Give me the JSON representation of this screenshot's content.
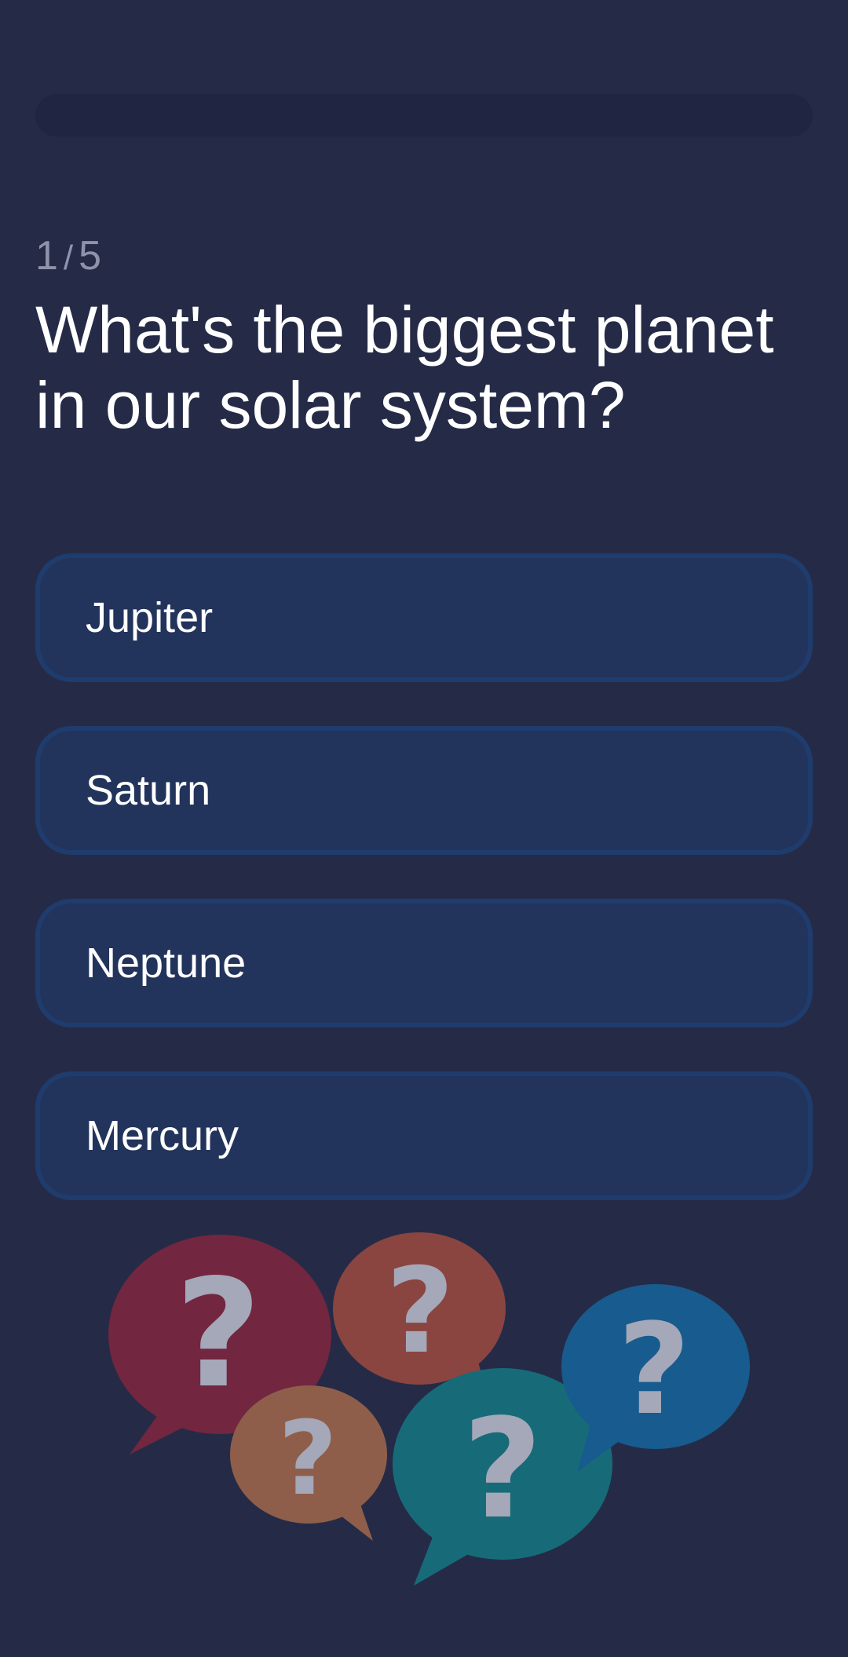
{
  "progress": {
    "value": 0
  },
  "counter": {
    "current": "1",
    "separator": "/",
    "total": "5"
  },
  "question": {
    "text": "What's the biggest planet in our solar system?"
  },
  "answers": [
    {
      "label": "Jupiter"
    },
    {
      "label": "Saturn"
    },
    {
      "label": "Neptune"
    },
    {
      "label": "Mercury"
    }
  ],
  "illustration": {
    "icon": "question-bubbles-icon",
    "mark": "?",
    "colors": {
      "red": "#72263f",
      "orange": "#8a4540",
      "tan": "#8f5e4b",
      "teal": "#176b79",
      "blue": "#185b8e",
      "mark": "#a4a8b8"
    }
  },
  "theme": {
    "background": "#252b47",
    "answer_bg": "#22345c",
    "answer_border": "#1f3c6e",
    "text": "#ffffff",
    "muted": "#8e93aa"
  }
}
